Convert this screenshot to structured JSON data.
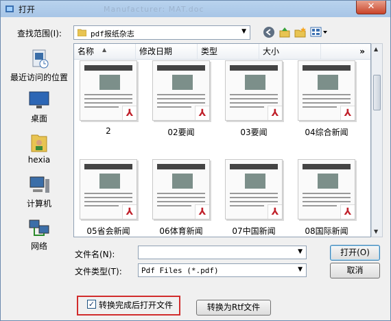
{
  "window": {
    "title": "打开",
    "ghost_text": "Manufacturer: MAT.doc",
    "close_glyph": "✕"
  },
  "lookin": {
    "label": "查找范围(I):",
    "value": "pdf报纸杂志"
  },
  "toolbar_icons": [
    "back-icon",
    "up-folder-icon",
    "new-folder-icon",
    "view-menu-icon"
  ],
  "places": [
    {
      "label": "最近访问的位置",
      "icon": "recent-places-icon"
    },
    {
      "label": "桌面",
      "icon": "desktop-icon"
    },
    {
      "label": "hexia",
      "icon": "user-folder-icon"
    },
    {
      "label": "计算机",
      "icon": "computer-icon"
    },
    {
      "label": "网络",
      "icon": "network-icon"
    }
  ],
  "columns": {
    "name": "名称",
    "modified": "修改日期",
    "type": "类型",
    "size": "大小",
    "more": "»"
  },
  "files": [
    {
      "name": "2"
    },
    {
      "name": "02要闻"
    },
    {
      "name": "03要闻"
    },
    {
      "name": "04综合新闻"
    },
    {
      "name": "05省会新闻"
    },
    {
      "name": "06体育新闻"
    },
    {
      "name": "07中国新闻"
    },
    {
      "name": "08国际新闻"
    }
  ],
  "filename": {
    "label": "文件名(N):",
    "value": ""
  },
  "filetype": {
    "label": "文件类型(T):",
    "value": "Pdf Files (*.pdf)"
  },
  "buttons": {
    "open": "打开(O)",
    "cancel": "取消",
    "convert": "转换为Rtf文件"
  },
  "convert_option": {
    "label": "转换完成后打开文件",
    "checked": true
  },
  "colors": {
    "highlight_border": "#d12b2b",
    "pdf_mark": "#c0202a",
    "window_frame": "#c9dcef"
  }
}
